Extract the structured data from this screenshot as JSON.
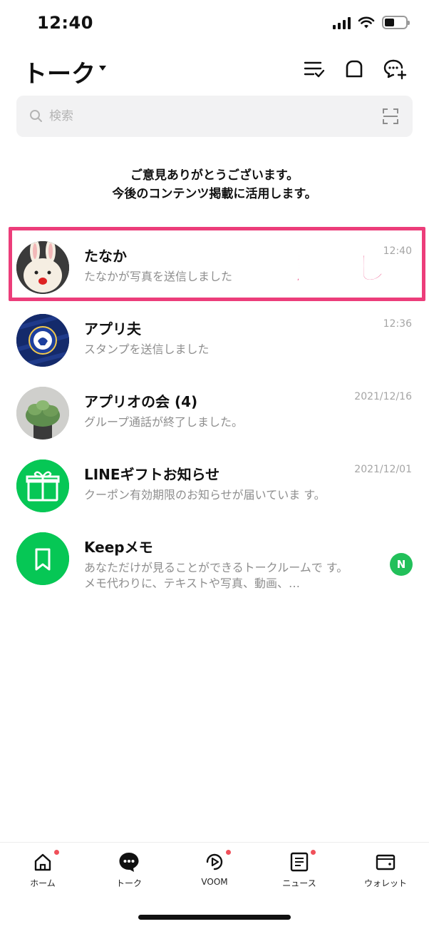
{
  "status_bar": {
    "time": "12:40"
  },
  "header": {
    "title": "トーク"
  },
  "search": {
    "placeholder": "検索"
  },
  "notice": {
    "line1": "ご意見ありがとうございます。",
    "line2": "今後のコンテンツ掲載に活用します。"
  },
  "annotation": {
    "label": "長押し",
    "color": "#ec3d7a"
  },
  "chats": [
    {
      "name": "たなか",
      "preview": "たなかが写真を送信しました",
      "time": "12:40"
    },
    {
      "name": "アプリ夫",
      "preview": "スタンプを送信しました",
      "time": "12:36"
    },
    {
      "name": "アプリオの会 (4)",
      "preview": "グループ通話が終了しました。",
      "time": "2021/12/16"
    },
    {
      "name": "LINEギフトお知らせ",
      "preview": "クーポン有効期限のお知らせが届いていま す。",
      "time": "2021/12/01"
    },
    {
      "name": "Keepメモ",
      "preview": "あなただけが見ることができるトークルームで す。メモ代わりに、テキストや写真、動画、…",
      "time": "",
      "badge": "N"
    }
  ],
  "tabs": [
    {
      "label": "ホーム",
      "icon": "home-icon"
    },
    {
      "label": "トーク",
      "icon": "chat-bubble-icon"
    },
    {
      "label": "VOOM",
      "icon": "voom-play-icon"
    },
    {
      "label": "ニュース",
      "icon": "news-icon"
    },
    {
      "label": "ウォレット",
      "icon": "wallet-icon"
    }
  ],
  "colors": {
    "line_green": "#06c755",
    "badge_dot": "#f0505a"
  }
}
